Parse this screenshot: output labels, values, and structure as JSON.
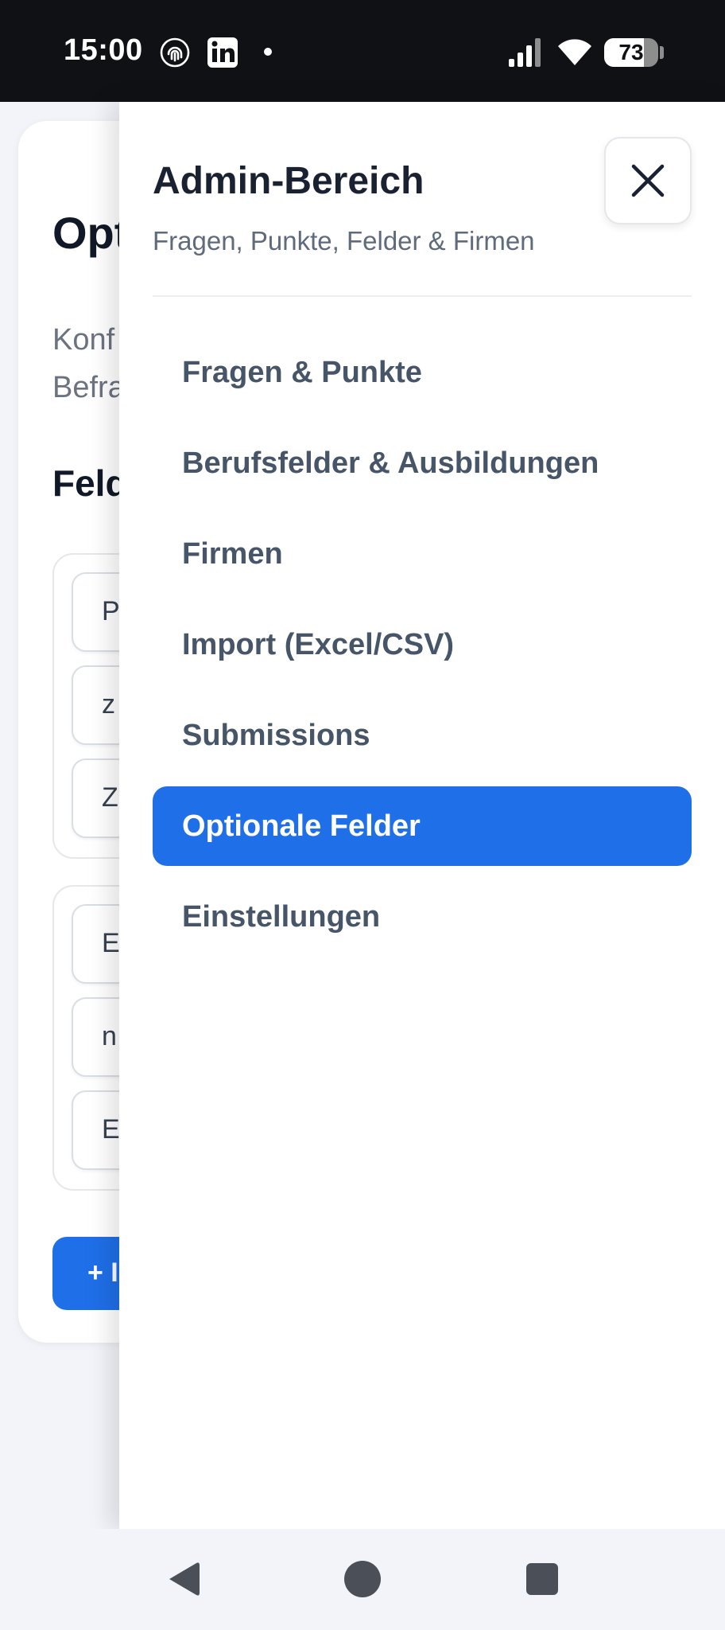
{
  "status_bar": {
    "time": "15:00",
    "icons": [
      "fingerprint-icon",
      "linkedin-icon",
      "notification-dot-icon",
      "signal-icon",
      "wifi-icon",
      "battery-icon"
    ],
    "battery_level": "73",
    "battery_fraction": 0.73
  },
  "background_page": {
    "title_visible": "Opt",
    "description_visible": "Konf\nBefra",
    "section_title_visible": "Feld",
    "group1_fields": [
      "P",
      "z",
      "Z"
    ],
    "group2_fields": [
      "E",
      "n",
      "E"
    ],
    "add_button_visible": "+ I"
  },
  "drawer": {
    "title": "Admin-Bereich",
    "subtitle": "Fragen, Punkte, Felder & Firmen",
    "close_icon": "close-icon",
    "nav_items": [
      {
        "label": "Fragen & Punkte",
        "active": false
      },
      {
        "label": "Berufsfelder & Ausbildungen",
        "active": false
      },
      {
        "label": "Firmen",
        "active": false
      },
      {
        "label": "Import (Excel/CSV)",
        "active": false
      },
      {
        "label": "Submissions",
        "active": false
      },
      {
        "label": "Optionale Felder",
        "active": true
      },
      {
        "label": "Einstellungen",
        "active": false
      }
    ]
  },
  "colors": {
    "accent": "#1f6fe8",
    "status_bar_bg": "#101114",
    "page_bg": "#f2f4f9",
    "nav_text": "#475569"
  },
  "nav_bar": {
    "buttons": [
      "back-icon",
      "home-icon",
      "recents-icon"
    ]
  }
}
